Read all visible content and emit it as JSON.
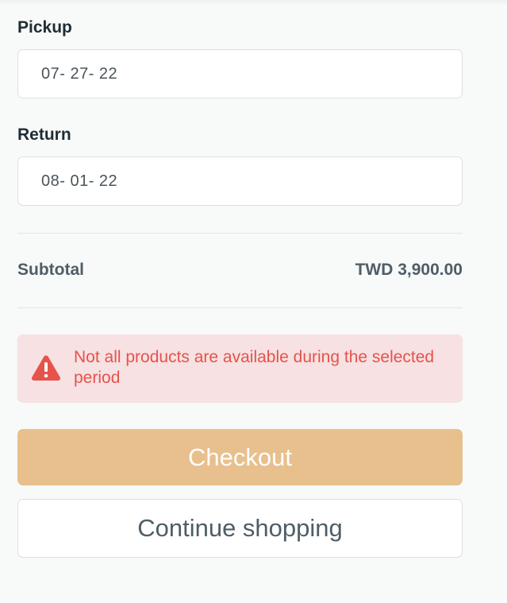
{
  "pickup": {
    "label": "Pickup",
    "date": "07- 27- 22"
  },
  "return": {
    "label": "Return",
    "date": "08- 01- 22"
  },
  "summary": {
    "subtotal_label": "Subtotal",
    "subtotal_value": "TWD 3,900.00"
  },
  "alert": {
    "icon": "warning-triangle-icon",
    "message": "Not all products are available during the selected period",
    "color": "#e5534b",
    "background": "#f7e1e2"
  },
  "actions": {
    "checkout_label": "Checkout",
    "continue_label": "Continue shopping",
    "checkout_color": "#e8c08d"
  }
}
